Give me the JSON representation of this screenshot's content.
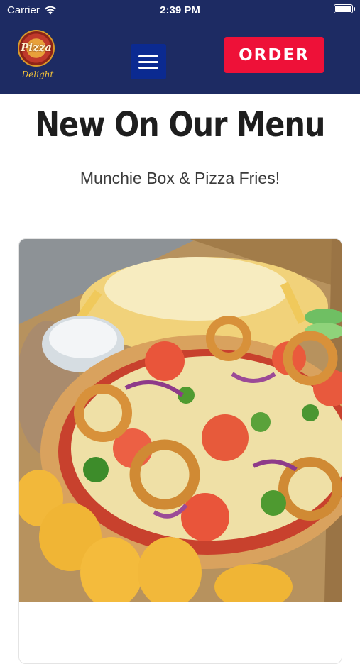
{
  "status_bar": {
    "carrier": "Carrier",
    "time": "2:39 PM"
  },
  "header": {
    "logo_text": "Pizza",
    "logo_subtext": "Delight",
    "order_label": "ORDER",
    "colors": {
      "background": "#1d2b63",
      "order": "#ee1138",
      "menu": "#0b2a91"
    }
  },
  "hero": {
    "title": "New On Our Menu",
    "subtitle": "Munchie Box & Pizza Fries!"
  },
  "card": {
    "image_subject": "pizza-with-fries-and-nuggets-photo"
  }
}
